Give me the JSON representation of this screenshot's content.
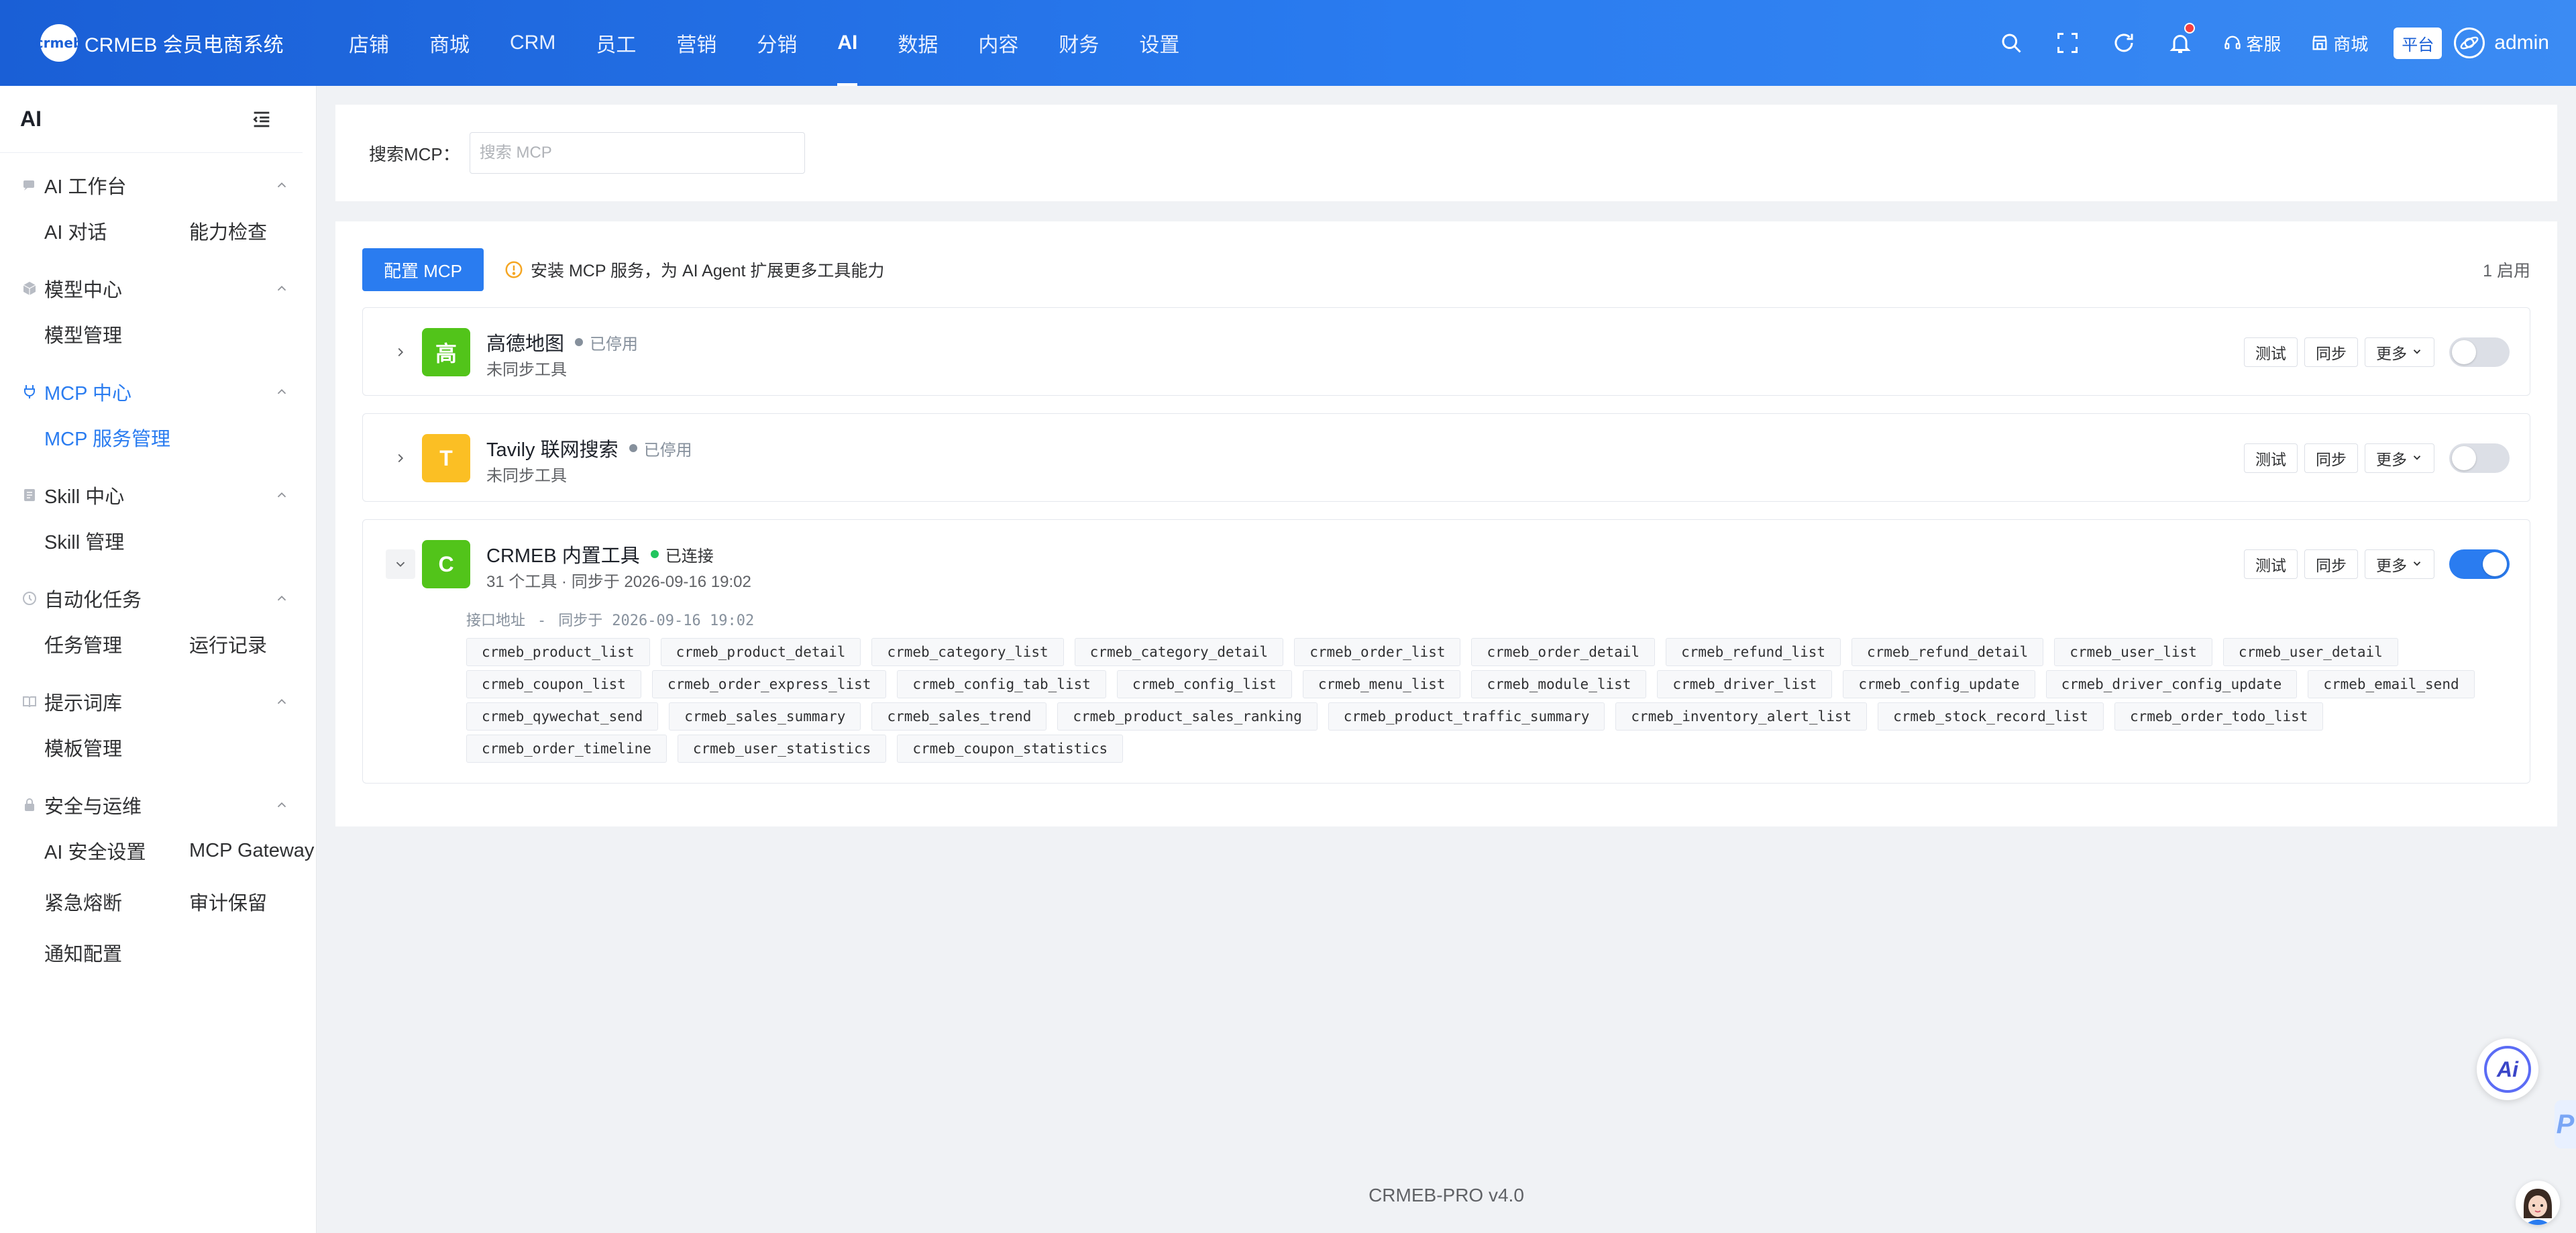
{
  "brand": {
    "logo_text": "crmeb",
    "name": "CRMEB 会员电商系统"
  },
  "nav": [
    {
      "label": "店铺"
    },
    {
      "label": "商城"
    },
    {
      "label": "CRM"
    },
    {
      "label": "员工"
    },
    {
      "label": "营销"
    },
    {
      "label": "分销"
    },
    {
      "label": "AI",
      "active": true
    },
    {
      "label": "数据"
    },
    {
      "label": "内容"
    },
    {
      "label": "财务"
    },
    {
      "label": "设置"
    }
  ],
  "topbar": {
    "icons": [
      "search-icon",
      "fullscreen-icon",
      "refresh-icon",
      "bell-icon"
    ],
    "service_label": "客服",
    "mall_label": "商城",
    "platform_label": "平台",
    "user_name": "admin"
  },
  "sidebar": {
    "title": "AI",
    "groups": [
      {
        "label": "AI 工作台",
        "icon": "chat-icon",
        "items": [
          "AI 对话",
          "能力检查"
        ]
      },
      {
        "label": "模型中心",
        "icon": "cube-icon",
        "items": [
          "模型管理"
        ]
      },
      {
        "label": "MCP 中心",
        "icon": "plug-icon",
        "active": true,
        "items": [
          "MCP 服务管理"
        ]
      },
      {
        "label": "Skill 中心",
        "icon": "doc-icon",
        "items": [
          "Skill 管理"
        ]
      },
      {
        "label": "自动化任务",
        "icon": "clock-icon",
        "items": [
          "任务管理",
          "运行记录"
        ]
      },
      {
        "label": "提示词库",
        "icon": "book-icon",
        "items": [
          "模板管理"
        ]
      },
      {
        "label": "安全与运维",
        "icon": "lock-icon",
        "items": [
          "AI 安全设置",
          "MCP Gateway",
          "紧急熔断",
          "审计保留",
          "通知配置"
        ]
      }
    ]
  },
  "search": {
    "label": "搜索MCP：",
    "placeholder": "搜索 MCP",
    "value": ""
  },
  "list": {
    "config_button": "配置 MCP",
    "hint": "安装 MCP 服务，为 AI Agent 扩展更多工具能力",
    "count": "1 启用"
  },
  "services": [
    {
      "avatar": "高",
      "avatar_color": "#52c41a",
      "name": "高德地图",
      "status": "已停用",
      "sub": "未同步工具",
      "enabled": false,
      "expanded": false
    },
    {
      "avatar": "T",
      "avatar_color": "#fbbf24",
      "name": "Tavily 联网搜索",
      "status": "已停用",
      "sub": "未同步工具",
      "enabled": false,
      "expanded": false
    },
    {
      "avatar": "C",
      "avatar_color": "#52c41a",
      "name": "CRMEB 内置工具",
      "status": "已连接",
      "sub": "31 个工具 · 同步于 2026-09-16 19:02",
      "enabled": true,
      "expanded": true,
      "meta_endpoint_label": "接口地址",
      "meta_endpoint": "-",
      "meta_sync_label": "同步于",
      "meta_sync": "2026-09-16 19:02",
      "tools": [
        "crmeb_product_list",
        "crmeb_product_detail",
        "crmeb_category_list",
        "crmeb_category_detail",
        "crmeb_order_list",
        "crmeb_order_detail",
        "crmeb_refund_list",
        "crmeb_refund_detail",
        "crmeb_user_list",
        "crmeb_user_detail",
        "crmeb_coupon_list",
        "crmeb_order_express_list",
        "crmeb_config_tab_list",
        "crmeb_config_list",
        "crmeb_menu_list",
        "crmeb_module_list",
        "crmeb_driver_list",
        "crmeb_config_update",
        "crmeb_driver_config_update",
        "crmeb_email_send",
        "crmeb_qywechat_send",
        "crmeb_sales_summary",
        "crmeb_sales_trend",
        "crmeb_product_sales_ranking",
        "crmeb_product_traffic_summary",
        "crmeb_inventory_alert_list",
        "crmeb_stock_record_list",
        "crmeb_order_todo_list",
        "crmeb_order_timeline",
        "crmeb_user_statistics",
        "crmeb_coupon_statistics"
      ]
    }
  ],
  "service_actions": {
    "test": "测试",
    "sync": "同步",
    "more": "更多"
  },
  "footer": "CRMEB-PRO v4.0",
  "floating": {
    "ai_button": "Ai",
    "edge_tab": "P"
  },
  "colors": {
    "primary": "#2a7cf0",
    "topbar_start": "#1a5fd6",
    "topbar_end": "#3b8bf3",
    "success": "#22c55e",
    "warning": "#f5a623"
  }
}
